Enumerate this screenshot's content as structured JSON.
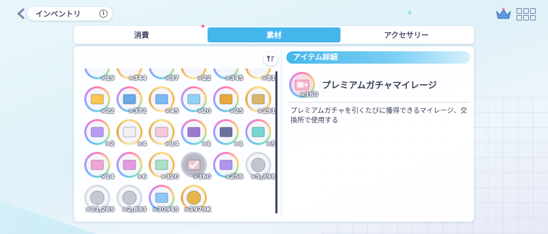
{
  "header": {
    "back_label": "‹",
    "title": "インベントリ",
    "info_label": "i"
  },
  "tabs": [
    {
      "label": "消費",
      "active": false
    },
    {
      "label": "素材",
      "active": true
    },
    {
      "label": "アクセサリー",
      "active": false
    }
  ],
  "colors": {
    "accent": "#45b6ec",
    "text": "#3c3f5a",
    "highlight_sparkle": "#ff4f7b"
  },
  "inventory": {
    "partial_row_counts": [
      "×19",
      "×344",
      "×37",
      "×22",
      "×345",
      "×81"
    ],
    "items": [
      {
        "icon": "rainbow-ticket-icon",
        "count": "×22",
        "ring": "rainbow",
        "fill": "#f7c84a"
      },
      {
        "icon": "blue-book-icon",
        "count": "×372",
        "ring": "rainbow",
        "fill": "#6aa8e8"
      },
      {
        "icon": "gold-book-icon",
        "count": "×45",
        "ring": "gold",
        "fill": "#7ab8f0"
      },
      {
        "icon": "music-box-icon",
        "count": "×20",
        "ring": "rainbow",
        "fill": "#8fd2f4"
      },
      {
        "icon": "gold-crystal-icon",
        "count": "×25",
        "ring": "rainbow",
        "fill": "#e9a83a"
      },
      {
        "icon": "bottles-icon",
        "count": "×291",
        "ring": "gold",
        "fill": "#d9b86a"
      },
      {
        "icon": "prism-gem-icon",
        "count": "×2",
        "ring": "rainbow",
        "fill": "#b69cf5"
      },
      {
        "icon": "magnifier-icon",
        "count": "×4",
        "ring": "gold",
        "fill": "#f0f0f4"
      },
      {
        "icon": "flower-card-icon",
        "count": "×14",
        "ring": "gold",
        "fill": "#f6c9d8"
      },
      {
        "icon": "character-purple-icon",
        "count": "×1",
        "ring": "rainbow",
        "fill": "#9b7ad0"
      },
      {
        "icon": "character-silver-icon",
        "count": "×1",
        "ring": "rainbow",
        "fill": "#6d6f9e"
      },
      {
        "icon": "green-ticket-icon",
        "count": "×5",
        "ring": "rainbow",
        "fill": "#7ad6d0"
      },
      {
        "icon": "pink-ticket-icon",
        "count": "×14",
        "ring": "rainbow",
        "fill": "#f3a6d4"
      },
      {
        "icon": "pink-gem-ticket-icon",
        "count": "×6",
        "ring": "rainbow",
        "fill": "#e49adf"
      },
      {
        "icon": "green-card-icon",
        "count": "×120",
        "ring": "gold",
        "fill": "#a9e0c8"
      },
      {
        "icon": "mileage-ticket-icon",
        "count": "×160",
        "ring": "sel",
        "fill": "#e8c9d4",
        "selected": true
      },
      {
        "icon": "purple-crystal-icon",
        "count": "×256",
        "ring": "rainbow",
        "fill": "#b293f0"
      },
      {
        "icon": "silver-token-icon",
        "count": "×5,398",
        "ring": "silver",
        "fill": "#c4c6cf"
      },
      {
        "icon": "silver-coin-icon",
        "count": "×11,269",
        "ring": "silver",
        "fill": "#c7c9d2"
      },
      {
        "icon": "silver-medal-icon",
        "count": "×2,893",
        "ring": "silver",
        "fill": "#c7c9d2"
      },
      {
        "icon": "star-shard-icon",
        "count": "×30945",
        "ring": "rainbow",
        "fill": "#8ec7f5"
      },
      {
        "icon": "gold-coin-icon",
        "count": "×3979K",
        "ring": "gold",
        "fill": "#e6b64a"
      }
    ]
  },
  "detail": {
    "header": "アイテム詳細",
    "name": "プレミアムガチャマイレージ",
    "count": "×160",
    "description": "プレミアムガチャを引くたびに獲得できるマイレージ、交換所で使用する"
  }
}
